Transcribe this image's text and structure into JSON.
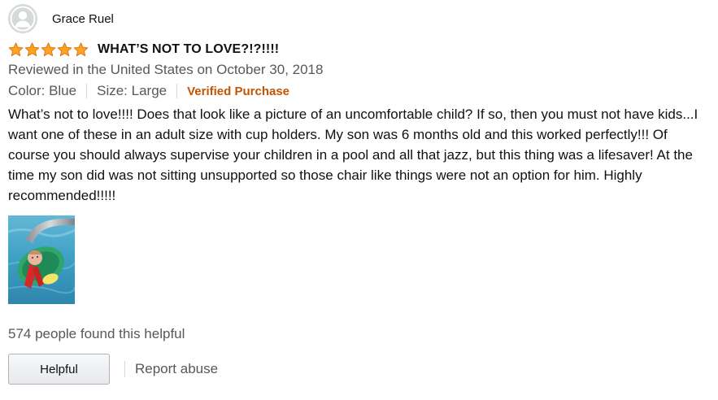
{
  "profile": {
    "name": "Grace Ruel",
    "avatar_icon": "person-silhouette-icon"
  },
  "rating": {
    "stars": 5,
    "max": 5,
    "color": "#ffa41c"
  },
  "review": {
    "title": "WHAT’S NOT TO LOVE?!?!!!!",
    "date_text": "Reviewed in the United States on October 30, 2018",
    "color_label": "Color: Blue",
    "size_label": "Size: Large",
    "verified_label": "Verified Purchase",
    "body": "What’s not to love!!!! Does that look like a picture of an uncomfortable child? If so, then you must not have kids...I want one of these in an adult size with cup holders. My son was 6 months old and this worked perfectly!!! Of course you should always supervise your children in a pool and all that jazz, but this thing was a lifesaver! At the time my son did was not sitting unsupported so those chair like things were not an option for him. Highly recommended!!!!!"
  },
  "helpful": {
    "count_text": "574 people found this helpful",
    "button_label": "Helpful",
    "report_label": "Report abuse"
  },
  "colors": {
    "verified": "#c45500",
    "secondary_text": "#565959",
    "primary_text": "#111111"
  }
}
